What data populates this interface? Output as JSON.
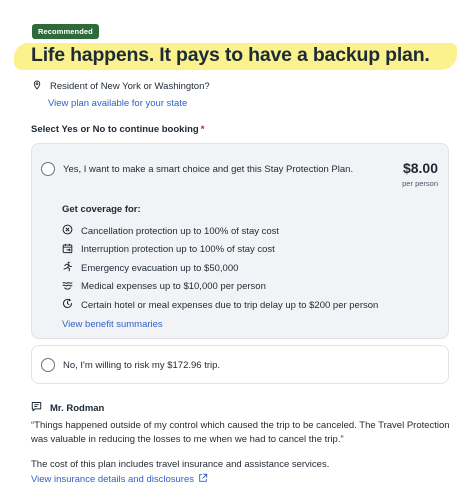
{
  "badge": "Recommended",
  "headline": "Life happens. It pays to have a backup plan.",
  "resident": {
    "icon": "location-pin-icon",
    "text": "Resident of New York or Washington?",
    "link": "View plan available for your state"
  },
  "select_prompt": {
    "label": "Select Yes or No to continue booking",
    "required_mark": "*"
  },
  "yes_option": {
    "label": "Yes, I want to make a smart choice and get this Stay Protection Plan.",
    "price": "$8.00",
    "price_unit": "per person",
    "coverage_title": "Get coverage for:",
    "coverage_items": [
      {
        "icon": "circle-x-icon",
        "text": "Cancellation protection up to 100% of stay cost"
      },
      {
        "icon": "calendar-interrupt-icon",
        "text": "Interruption protection up to 100% of stay cost"
      },
      {
        "icon": "running-person-icon",
        "text": "Emergency evacuation up to $50,000"
      },
      {
        "icon": "medical-waves-icon",
        "text": "Medical expenses up to $10,000 per person"
      },
      {
        "icon": "clock-delay-icon",
        "text": "Certain hotel or meal expenses due to trip delay up to $200 per person"
      }
    ],
    "benefit_link": "View benefit summaries"
  },
  "no_option": {
    "label": "No, I'm willing to risk my $172.96 trip."
  },
  "review": {
    "icon": "chat-quote-icon",
    "name": "Mr. Rodman",
    "quote": "“Things happened outside of my control which caused the trip to be canceled. The Travel Protection was valuable in reducing the losses to me when we had to cancel the trip.”"
  },
  "cost_note": "The cost of this plan includes travel insurance and assistance services.",
  "disclosure_link": "View insurance details and disclosures",
  "colors": {
    "badge": "#2f6b3a",
    "highlight": "#fbf28d",
    "link": "#2f62c7",
    "required": "#d4143a",
    "option_bg": "#f2f3f7"
  }
}
